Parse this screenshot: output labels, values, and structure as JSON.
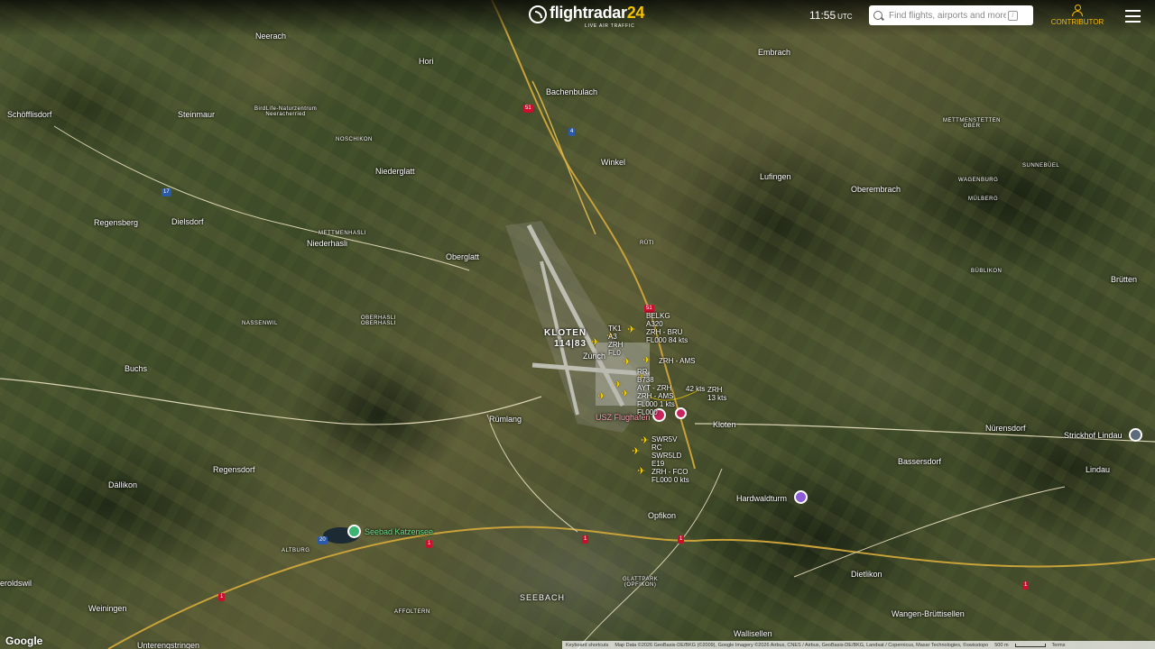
{
  "header": {
    "logo_text": "flightradar",
    "logo_num": "24",
    "logo_tagline": "LIVE AIR TRAFFIC",
    "time": "11:55",
    "time_zone": "UTC",
    "search_placeholder": "Find flights, airports and more",
    "search_shortcut": "/",
    "contributor_label": "CONTRIBUTOR"
  },
  "places": [
    {
      "id": "neerach",
      "text": "Neerach"
    },
    {
      "id": "hori",
      "text": "Hori"
    },
    {
      "id": "bachenbulach",
      "text": "Bachenbulach"
    },
    {
      "id": "embrach",
      "text": "Embrach"
    },
    {
      "id": "schofflisdorf",
      "text": "Schöfflisdorf"
    },
    {
      "id": "steinmaur",
      "text": "Steinmaur"
    },
    {
      "id": "birdlife",
      "text": "BirdLife-Naturzentrum\nNeeracherried"
    },
    {
      "id": "noschikon",
      "text": "NOSCHIKON"
    },
    {
      "id": "winkel",
      "text": "Winkel"
    },
    {
      "id": "mettmenstetten",
      "text": "METTMENSTETTEN\nOBER"
    },
    {
      "id": "niederglatt",
      "text": "Niederglatt"
    },
    {
      "id": "lufingen",
      "text": "Lufingen"
    },
    {
      "id": "sunnebuel",
      "text": "SUNNEBÜEL"
    },
    {
      "id": "wagenburg",
      "text": "WAGENBURG"
    },
    {
      "id": "oberembrach",
      "text": "Oberembrach"
    },
    {
      "id": "mulberg",
      "text": "MÜLBERG"
    },
    {
      "id": "regensberg",
      "text": "Regensberg"
    },
    {
      "id": "dielsdorf",
      "text": "Dielsdorf"
    },
    {
      "id": "mettmenhasli",
      "text": "METTMENHASLI"
    },
    {
      "id": "niederhasli",
      "text": "Niederhasli"
    },
    {
      "id": "ruti",
      "text": "RÜTI"
    },
    {
      "id": "oberglatt",
      "text": "Oberglatt"
    },
    {
      "id": "bubliikon",
      "text": "BÜBLIKON"
    },
    {
      "id": "brutten",
      "text": "Brütten"
    },
    {
      "id": "nassenwil",
      "text": "NASSENWIL"
    },
    {
      "id": "oberhasli",
      "text": "OBERHASLI\nOBERHASLI"
    },
    {
      "id": "kloten_airport",
      "text": "KLOTEN"
    },
    {
      "id": "kloten_code",
      "text": "114|83"
    },
    {
      "id": "zurich_airport",
      "text": "Zürich"
    },
    {
      "id": "buchs",
      "text": "Buchs"
    },
    {
      "id": "rumlang",
      "text": "Rümlang"
    },
    {
      "id": "kloten",
      "text": "Kloten"
    },
    {
      "id": "nurensdorf",
      "text": "Nürensdorf"
    },
    {
      "id": "strickhof",
      "text": "Strickhof Lindau"
    },
    {
      "id": "bassersdorf",
      "text": "Bassersdorf"
    },
    {
      "id": "lindau",
      "text": "Lindau"
    },
    {
      "id": "regensdorf",
      "text": "Regensdorf"
    },
    {
      "id": "dallikon",
      "text": "Dällikon"
    },
    {
      "id": "hardwaldturm",
      "text": "Hardwaldturm"
    },
    {
      "id": "opfikon",
      "text": "Opfikon"
    },
    {
      "id": "seebad",
      "text": "Seebad Katzensee"
    },
    {
      "id": "altburg",
      "text": "ALTBURG"
    },
    {
      "id": "dietlikon",
      "text": "Dietlikon"
    },
    {
      "id": "glattpark",
      "text": "GLATTPARK\n(OPFIKON)"
    },
    {
      "id": "eroldswil",
      "text": "eroldswil"
    },
    {
      "id": "weiningen",
      "text": "Weiningen"
    },
    {
      "id": "affoltern",
      "text": "AFFOLTERN"
    },
    {
      "id": "seebach",
      "text": "SEEBACH"
    },
    {
      "id": "wangen",
      "text": "Wangen-Brüttisellen"
    },
    {
      "id": "wallisellen",
      "text": "Wallisellen"
    },
    {
      "id": "unterengstringen",
      "text": "Unterengstringen"
    },
    {
      "id": "usz_flughafen",
      "text": "USZ Flughafen"
    }
  ],
  "aircraft_labels": [
    {
      "id": "belkg",
      "text": "BELKG\nA320\nZRH - BRU\nFL000 84 kts"
    },
    {
      "id": "tk",
      "text": "TK1\nA3\nZRH\nFL0"
    },
    {
      "id": "zrh_ams",
      "text": "ZRH - AMS"
    },
    {
      "id": "b738",
      "text": "RR.\nB738\nAYT - ZRH\nZRH - AMS\nFL000 1 kts\nFL000"
    },
    {
      "id": "speed42",
      "text": "42 kts"
    },
    {
      "id": "zrh13",
      "text": "ZRH\n13 kts"
    },
    {
      "id": "swr",
      "text": "SWR5V\nRC\nSWR5LD\nE19\nZRH - FCO\nFL000 0 kts"
    }
  ],
  "shields": [
    {
      "id": "s1",
      "text": "51"
    },
    {
      "id": "s2",
      "text": "4"
    },
    {
      "id": "s3",
      "text": "17"
    },
    {
      "id": "s4",
      "text": "51"
    },
    {
      "id": "s5",
      "text": "1"
    },
    {
      "id": "s6",
      "text": "1"
    },
    {
      "id": "s7",
      "text": "1"
    },
    {
      "id": "s8",
      "text": "1"
    },
    {
      "id": "s9",
      "text": "1"
    },
    {
      "id": "s10",
      "text": "20"
    }
  ],
  "footer": {
    "google_logo": "Google",
    "shortcuts": "Keyboard shortcuts",
    "map_data": "Map Data ©2026 GeoBasis-DE/BKG (©2009), Google Imagery ©2026 Airbus, CNES / Airbus, GeoBasis-DE/BKG, Landsat / Copernicus, Maxar Technologies, ©swisstopo",
    "scale": "500 m",
    "terms": "Terms"
  },
  "colors": {
    "aircraft": "#f5d000",
    "accent": "#f5b800",
    "motorway_shield": "#c8102e"
  }
}
